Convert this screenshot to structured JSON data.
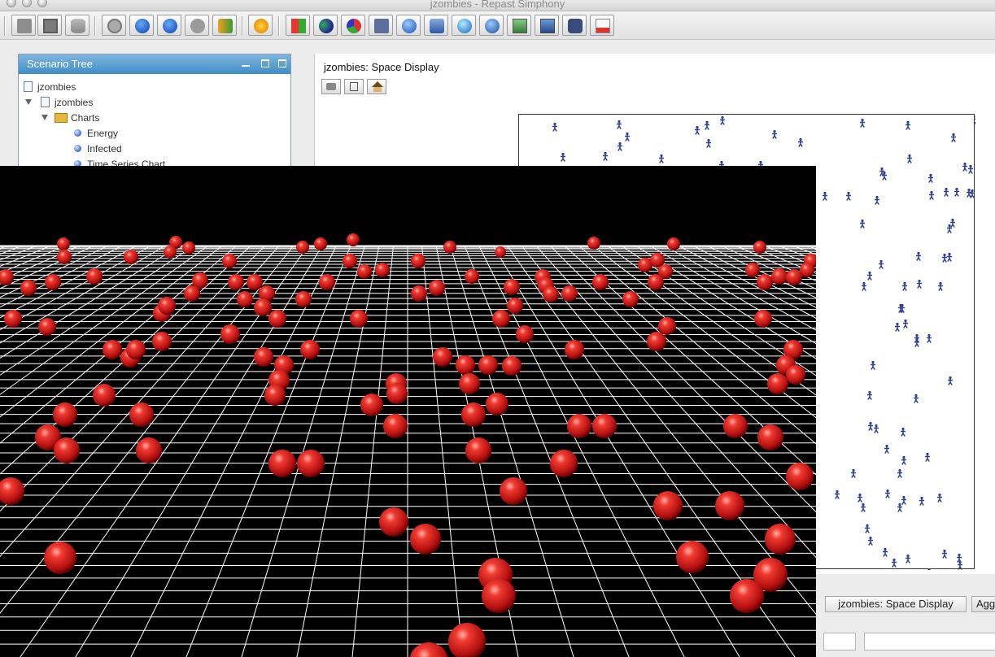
{
  "window": {
    "title": "jzombies - Repast Simphony"
  },
  "toolbar": {
    "buttons": [
      {
        "icon": "load-scenario-icon"
      },
      {
        "icon": "save-scenario-icon"
      },
      {
        "icon": "database-icon"
      },
      {
        "icon": "power-icon"
      },
      {
        "icon": "start-run-icon"
      },
      {
        "icon": "step-run-icon"
      },
      {
        "icon": "stop-run-icon"
      },
      {
        "icon": "reset-run-icon"
      },
      {
        "icon": "lightning-icon"
      },
      {
        "icon": "color-palette-icon"
      },
      {
        "icon": "agents-icon"
      },
      {
        "icon": "pie-chart-icon"
      },
      {
        "icon": "calculator-icon"
      },
      {
        "icon": "globe-icon"
      },
      {
        "icon": "magnifier-icon"
      },
      {
        "icon": "world-icon"
      },
      {
        "icon": "network-globe-icon"
      },
      {
        "icon": "image-icon"
      },
      {
        "icon": "grid-icon"
      },
      {
        "icon": "movie-icon"
      },
      {
        "icon": "document-icon"
      }
    ]
  },
  "scenario_tree": {
    "title": "Scenario Tree",
    "items": [
      {
        "label": "jzombies",
        "type": "doc",
        "level": 0
      },
      {
        "label": "jzombies",
        "type": "doc",
        "level": 1,
        "expanded": true
      },
      {
        "label": "Charts",
        "type": "folder",
        "level": 2,
        "expanded": true
      },
      {
        "label": "Energy",
        "type": "dot",
        "level": 3
      },
      {
        "label": "Infected",
        "type": "dot",
        "level": 3
      },
      {
        "label": "Time Series Chart",
        "type": "dot",
        "level": 3
      }
    ]
  },
  "display": {
    "title": "jzombies: Space Display",
    "buttons": [
      {
        "icon": "camera-icon"
      },
      {
        "icon": "layout-icon"
      },
      {
        "icon": "home-icon"
      }
    ]
  },
  "bottom_tabs": [
    {
      "label": "jzombies: Space Display",
      "active": true
    },
    {
      "label": "Agg",
      "active": false
    }
  ],
  "colors": {
    "agent": "#2b3f8c",
    "zombie_sphere": "#e02020",
    "grid_line": "#ffffff",
    "view_background": "#000000",
    "tree_header": "#4a93cc"
  }
}
